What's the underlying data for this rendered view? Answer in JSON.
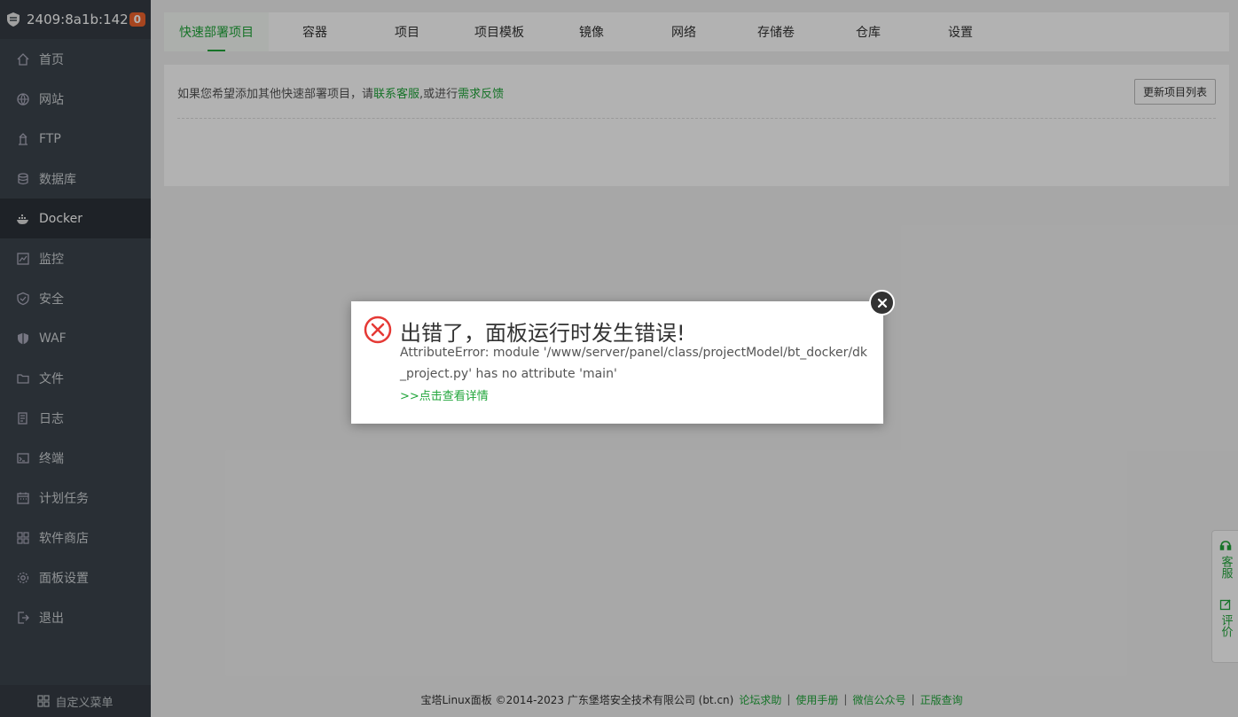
{
  "sidebar": {
    "host": "2409:8a1b:142:...",
    "badge": "0",
    "items": [
      {
        "label": "首页",
        "icon": "home-icon"
      },
      {
        "label": "网站",
        "icon": "globe-icon"
      },
      {
        "label": "FTP",
        "icon": "ftp-icon"
      },
      {
        "label": "数据库",
        "icon": "database-icon"
      },
      {
        "label": "Docker",
        "icon": "docker-icon",
        "active": true
      },
      {
        "label": "监控",
        "icon": "monitor-icon"
      },
      {
        "label": "安全",
        "icon": "shield-icon"
      },
      {
        "label": "WAF",
        "icon": "waf-icon"
      },
      {
        "label": "文件",
        "icon": "folder-icon"
      },
      {
        "label": "日志",
        "icon": "log-icon"
      },
      {
        "label": "终端",
        "icon": "terminal-icon"
      },
      {
        "label": "计划任务",
        "icon": "calendar-icon"
      },
      {
        "label": "软件商店",
        "icon": "apps-icon"
      },
      {
        "label": "面板设置",
        "icon": "gear-icon"
      },
      {
        "label": "退出",
        "icon": "logout-icon"
      }
    ],
    "footer": "自定义菜单"
  },
  "tabs": [
    {
      "label": "快速部署项目",
      "active": true
    },
    {
      "label": "容器"
    },
    {
      "label": "项目"
    },
    {
      "label": "项目模板"
    },
    {
      "label": "镜像"
    },
    {
      "label": "网络"
    },
    {
      "label": "存储卷"
    },
    {
      "label": "仓库"
    },
    {
      "label": "设置"
    }
  ],
  "panel": {
    "text_prefix": "如果您希望添加其他快速部署项目，请",
    "link1": "联系客服",
    "text_mid": ",或进行",
    "link2": "需求反馈",
    "refresh_button": "更新项目列表"
  },
  "footer": {
    "copyright": "宝塔Linux面板 ©2014-2023 广东堡塔安全技术有限公司 (bt.cn)",
    "links": [
      "论坛求助",
      "使用手册",
      "微信公众号",
      "正版查询"
    ]
  },
  "float_side": {
    "service": "客服",
    "review": "评价"
  },
  "modal": {
    "title": "出错了，面板运行时发生错误!",
    "message": "AttributeError: module '/www/server/panel/class/projectModel/bt_docker/dk_project.py' has no attribute 'main'",
    "link": ">>点击查看详情"
  },
  "colors": {
    "accent": "#20a53a",
    "sidebar": "#3c444d",
    "error": "#e53935",
    "badge": "#f0642d"
  }
}
